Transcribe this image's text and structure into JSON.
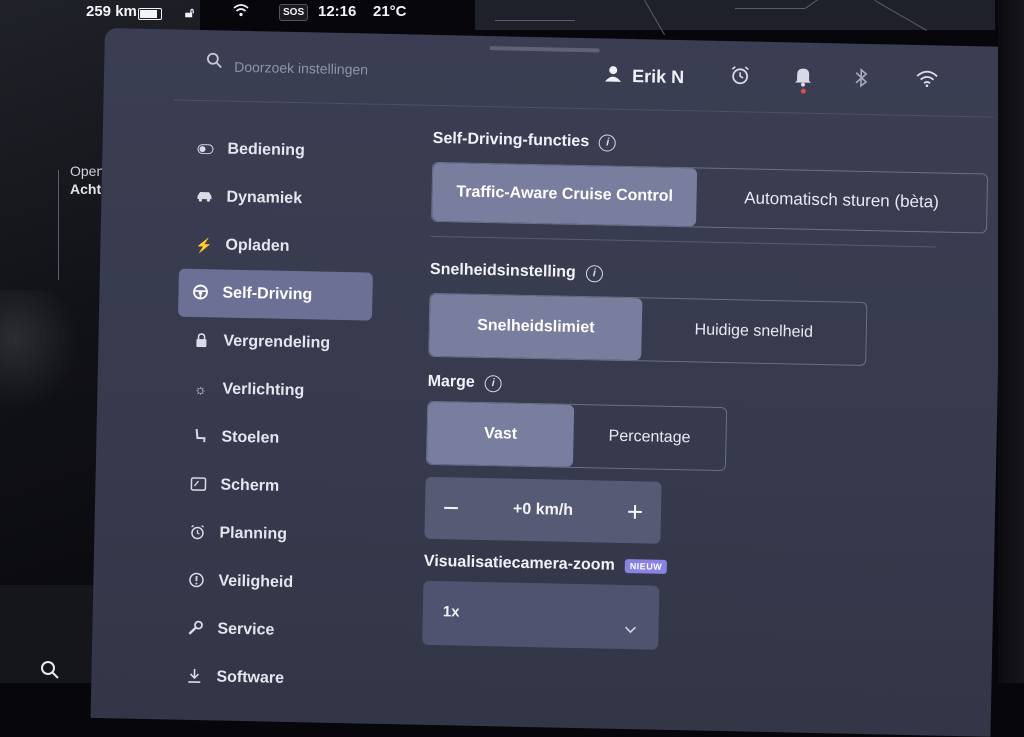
{
  "status_bar": {
    "range": "259 km",
    "sos": "SOS",
    "time": "12:16",
    "temperature": "21°C"
  },
  "car_panel": {
    "trunk_line1": "Open",
    "trunk_line2": "Achterbak"
  },
  "header": {
    "search_placeholder": "Doorzoek instellingen",
    "user_name": "Erik N"
  },
  "sidebar": {
    "items": [
      {
        "label": "Bediening",
        "icon": "toggle-icon"
      },
      {
        "label": "Dynamiek",
        "icon": "car-icon"
      },
      {
        "label": "Opladen",
        "icon": "bolt-icon"
      },
      {
        "label": "Self-Driving",
        "icon": "steering-wheel-icon",
        "active": true
      },
      {
        "label": "Vergrendeling",
        "icon": "lock-icon"
      },
      {
        "label": "Verlichting",
        "icon": "sun-icon"
      },
      {
        "label": "Stoelen",
        "icon": "seat-icon"
      },
      {
        "label": "Scherm",
        "icon": "screen-icon"
      },
      {
        "label": "Planning",
        "icon": "alarm-icon"
      },
      {
        "label": "Veiligheid",
        "icon": "alert-circle-icon"
      },
      {
        "label": "Service",
        "icon": "wrench-icon"
      },
      {
        "label": "Software",
        "icon": "download-icon"
      }
    ]
  },
  "self_driving": {
    "title": "Self-Driving-functies",
    "options": [
      "Traffic-Aware Cruise Control",
      "Automatisch sturen (bèta)"
    ],
    "selected": "Traffic-Aware Cruise Control"
  },
  "speed_setting": {
    "title": "Snelheidsinstelling",
    "options": [
      "Snelheidslimiet",
      "Huidige snelheid"
    ],
    "selected": "Snelheidslimiet"
  },
  "margin": {
    "title": "Marge",
    "options": [
      "Vast",
      "Percentage"
    ],
    "selected": "Vast",
    "value": "+0 km/h",
    "minus": "−",
    "plus": "+"
  },
  "camera_zoom": {
    "title": "Visualisatiecamera-zoom",
    "badge": "NIEUW",
    "value": "1x"
  },
  "colors": {
    "panel_bg": "#393c50",
    "active_bg": "#6c7095",
    "badge_bg": "#8a82e0",
    "notification_dot": "#e0484a"
  }
}
